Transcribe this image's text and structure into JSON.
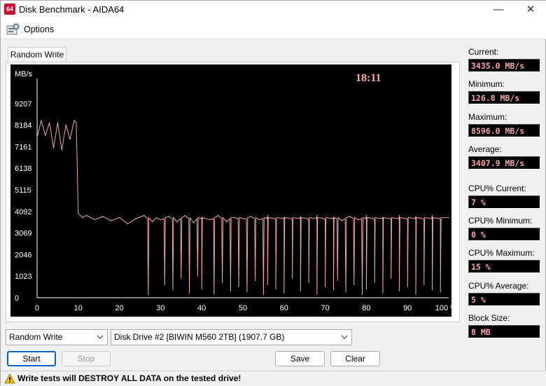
{
  "window": {
    "app_icon_text": "64",
    "title": "Disk Benchmark - AIDA64",
    "minimize_glyph": "—",
    "maximize_glyph": "☐",
    "close_glyph": "✕"
  },
  "menu": {
    "options_label": "Options",
    "options_icon": "options-icon"
  },
  "tab": {
    "label": "Random Write"
  },
  "chart_data": {
    "type": "line",
    "ylabel": "MB/s",
    "time_label": "18:11",
    "y_ticks": [
      "9207",
      "8184",
      "7161",
      "6138",
      "5115",
      "4092",
      "3069",
      "2046",
      "1023",
      "0"
    ],
    "x_ticks": [
      "0",
      "10",
      "20",
      "30",
      "40",
      "50",
      "60",
      "70",
      "80",
      "90",
      "100 %"
    ],
    "ylim": [
      0,
      10230
    ],
    "xlim": [
      0,
      100
    ],
    "x_unit": "%",
    "series_color": "#f4a6a6",
    "background": "#000000",
    "grid": false,
    "series": [
      {
        "x": [
          0,
          1,
          2,
          3,
          4,
          5,
          6,
          7,
          8,
          9,
          9.5,
          10,
          11,
          12,
          14,
          16,
          18,
          20,
          22,
          24,
          26,
          28,
          29,
          30,
          32,
          34,
          36,
          38,
          40,
          42,
          44,
          46,
          48,
          50,
          52,
          54,
          56,
          58,
          60,
          62,
          64,
          66,
          68,
          70,
          72,
          74,
          76,
          78,
          80,
          82,
          84,
          86,
          88,
          90,
          92,
          94,
          96,
          98,
          100
        ],
        "y": [
          7600,
          8400,
          7700,
          8300,
          7100,
          8300,
          7000,
          8200,
          7500,
          8400,
          8300,
          4000,
          3800,
          3900,
          3700,
          3850,
          3650,
          3800,
          3500,
          3750,
          3900,
          3600,
          3800,
          3700,
          3850,
          3600,
          3900,
          3550,
          3800,
          3700,
          3900,
          3600,
          3800,
          3750,
          3850,
          3700,
          3900,
          3650,
          3800,
          3700,
          3850,
          3600,
          3900,
          3700,
          3800,
          3650,
          3850,
          3700,
          3900,
          3600,
          3800,
          3750,
          3900,
          3700,
          3850,
          3650,
          3900,
          3700,
          3800
        ]
      }
    ],
    "dips": [
      27,
      31,
      33,
      35,
      37,
      39,
      40,
      43,
      45,
      47,
      49,
      51,
      53,
      55,
      56,
      58,
      60,
      62,
      64,
      66,
      68,
      70,
      72,
      73,
      75,
      77,
      79,
      80,
      82,
      84,
      86,
      88,
      90,
      92,
      94,
      96,
      98
    ],
    "dip_values": [
      120,
      600,
      350,
      900,
      200,
      1000,
      400,
      150,
      700,
      300,
      500,
      250,
      800,
      130,
      600,
      400,
      200,
      900,
      300,
      700,
      150,
      500,
      350,
      800,
      250,
      600,
      130,
      400,
      700,
      200,
      900,
      300,
      500,
      150,
      600,
      350,
      250
    ]
  },
  "stats": {
    "current_label": "Current:",
    "current_value": "3435.0 MB/s",
    "minimum_label": "Minimum:",
    "minimum_value": "126.8 MB/s",
    "maximum_label": "Maximum:",
    "maximum_value": "8596.0 MB/s",
    "average_label": "Average:",
    "average_value": "3407.9 MB/s",
    "cpu_current_label": "CPU% Current:",
    "cpu_current_value": "7 %",
    "cpu_minimum_label": "CPU% Minimum:",
    "cpu_minimum_value": "0 %",
    "cpu_maximum_label": "CPU% Maximum:",
    "cpu_maximum_value": "15 %",
    "cpu_average_label": "CPU% Average:",
    "cpu_average_value": "5 %",
    "block_size_label": "Block Size:",
    "block_size_value": "8 MB"
  },
  "controls": {
    "test_select": "Random Write",
    "drive_select": "Disk Drive #2  [BIWIN M560 2TB]  (1907.7 GB)",
    "start_label": "Start",
    "stop_label": "Stop",
    "save_label": "Save",
    "clear_label": "Clear"
  },
  "status": {
    "warning_text": "Write tests will DESTROY ALL DATA on the tested drive!"
  }
}
